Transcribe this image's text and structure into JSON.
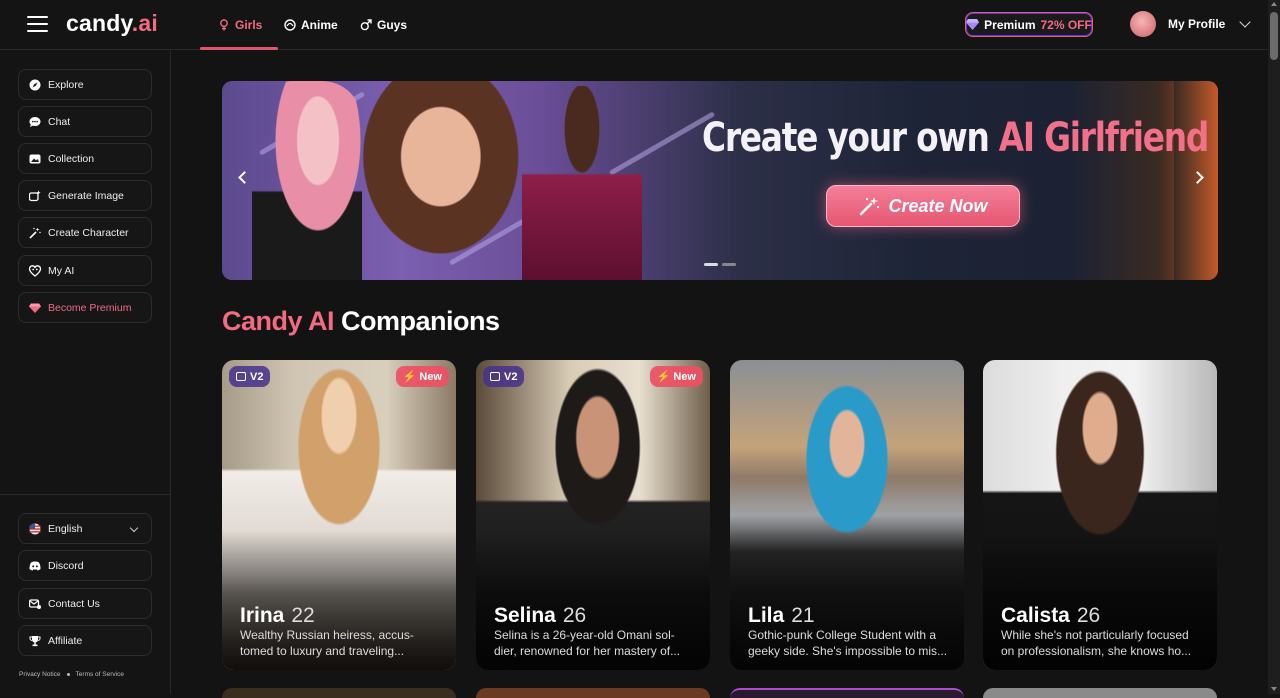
{
  "header": {
    "logo_main": "candy",
    "logo_accent": ".ai",
    "tabs": [
      {
        "label": "Girls",
        "active": true
      },
      {
        "label": "Anime",
        "active": false
      },
      {
        "label": "Guys",
        "active": false
      }
    ],
    "premium_label": "Premium",
    "premium_discount": "72% OFF",
    "profile_label": "My Profile"
  },
  "sidebar": {
    "items": [
      {
        "label": "Explore",
        "icon": "compass-icon"
      },
      {
        "label": "Chat",
        "icon": "chat-bubble-icon"
      },
      {
        "label": "Collection",
        "icon": "gallery-icon"
      },
      {
        "label": "Generate Image",
        "icon": "image-sparkle-icon"
      },
      {
        "label": "Create Character",
        "icon": "magic-wand-icon"
      },
      {
        "label": "My AI",
        "icon": "heart-mask-icon"
      },
      {
        "label": "Become Premium",
        "icon": "diamond-icon"
      }
    ],
    "language": "English",
    "bottom_items": [
      {
        "label": "Discord",
        "icon": "discord-icon"
      },
      {
        "label": "Contact Us",
        "icon": "contact-icon"
      },
      {
        "label": "Affiliate",
        "icon": "trophy-icon"
      }
    ],
    "privacy": "Privacy Notice",
    "terms": "Terms of Service"
  },
  "banner": {
    "title_main": "Create your own ",
    "title_accent": "AI Girlfriend",
    "cta": "Create Now",
    "slide_count": 2,
    "active_slide": 1
  },
  "section": {
    "title_accent": "Candy AI",
    "title_main": " Companions"
  },
  "cards": [
    {
      "name": "Irina",
      "age": "22",
      "desc": "Wealthy Russian heiress, accus-tomed to luxury and traveling...",
      "v2": "V2",
      "new": "New"
    },
    {
      "name": "Selina",
      "age": "26",
      "desc": "Selina is a 26-year-old Omani sol-dier, renowned for her mastery of...",
      "v2": "V2",
      "new": "New"
    },
    {
      "name": "Lila",
      "age": "21",
      "desc": "Gothic-punk College Student with a geeky side. She's impossible to mis...",
      "v2": null,
      "new": null
    },
    {
      "name": "Calista",
      "age": "26",
      "desc": "While she's not particularly focused on professionalism, she knows ho...",
      "v2": null,
      "new": null
    }
  ],
  "colors": {
    "accent": "#f26b82",
    "background": "#131313",
    "premium_border": "#e65f77"
  }
}
